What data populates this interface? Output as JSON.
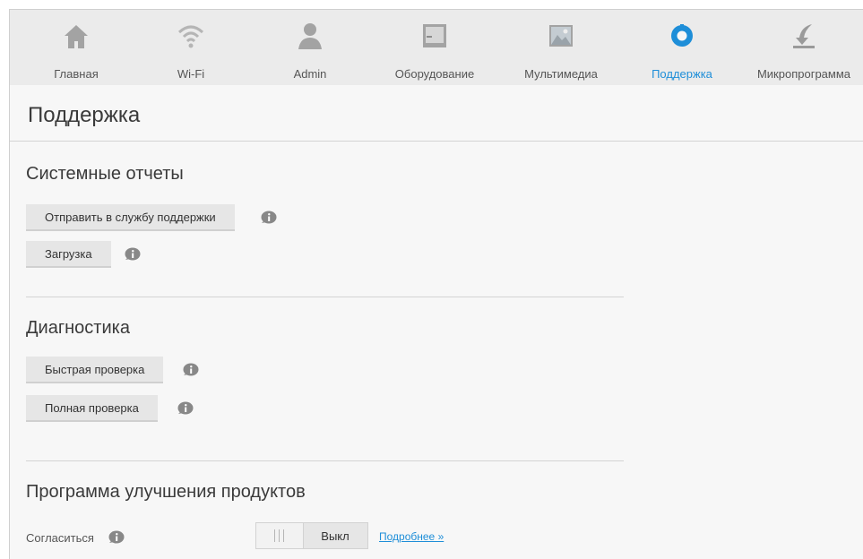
{
  "nav": {
    "items": [
      {
        "label": "Главная",
        "icon": "home-icon"
      },
      {
        "label": "Wi-Fi",
        "icon": "wifi-icon"
      },
      {
        "label": "Admin",
        "icon": "user-icon"
      },
      {
        "label": "Оборудование",
        "icon": "hardware-icon"
      },
      {
        "label": "Мультимедиа",
        "icon": "media-icon"
      },
      {
        "label": "Поддержка",
        "icon": "support-icon"
      },
      {
        "label": "Микропрограмма",
        "icon": "firmware-icon"
      }
    ],
    "active_label": "Поддержка"
  },
  "page": {
    "title": "Поддержка"
  },
  "reports": {
    "title": "Системные отчеты",
    "send_label": "Отправить в службу поддержки",
    "download_label": "Загрузка"
  },
  "diagnostics": {
    "title": "Диагностика",
    "quick_label": "Быстрая проверка",
    "full_label": "Полная проверка"
  },
  "improvement": {
    "title": "Программа улучшения продуктов",
    "agree_label": "Согласиться",
    "toggle_state": "Выкл",
    "more_link": "Подробнее »"
  },
  "colors": {
    "accent": "#1e8ed8",
    "icon_gray": "#a3a3a3",
    "info_icon": "#888888"
  }
}
